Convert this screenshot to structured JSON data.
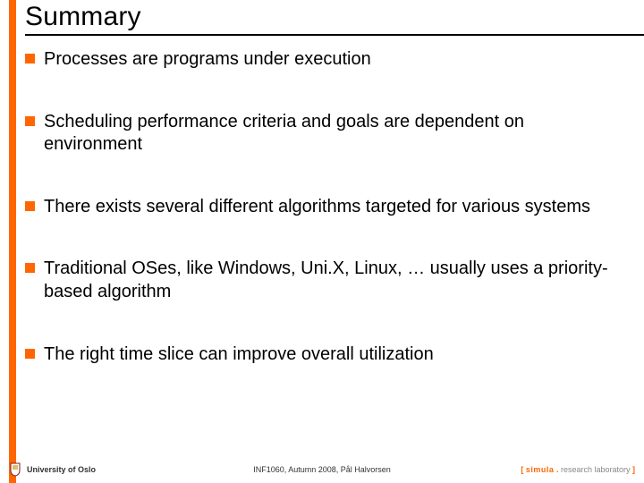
{
  "title": "Summary",
  "bullets": [
    "Processes are programs under execution",
    "Scheduling performance criteria and goals are dependent on environment",
    "There exists several different algorithms targeted for various systems",
    "Traditional OSes, like Windows, Uni.X, Linux, … usually uses a priority-based algorithm",
    "The right time slice can improve overall utilization"
  ],
  "footer": {
    "left": "University of Oslo",
    "center": "INF1060, Autumn 2008, Pål Halvorsen",
    "right_brand": "simula",
    "right_suffix": "research laboratory"
  }
}
